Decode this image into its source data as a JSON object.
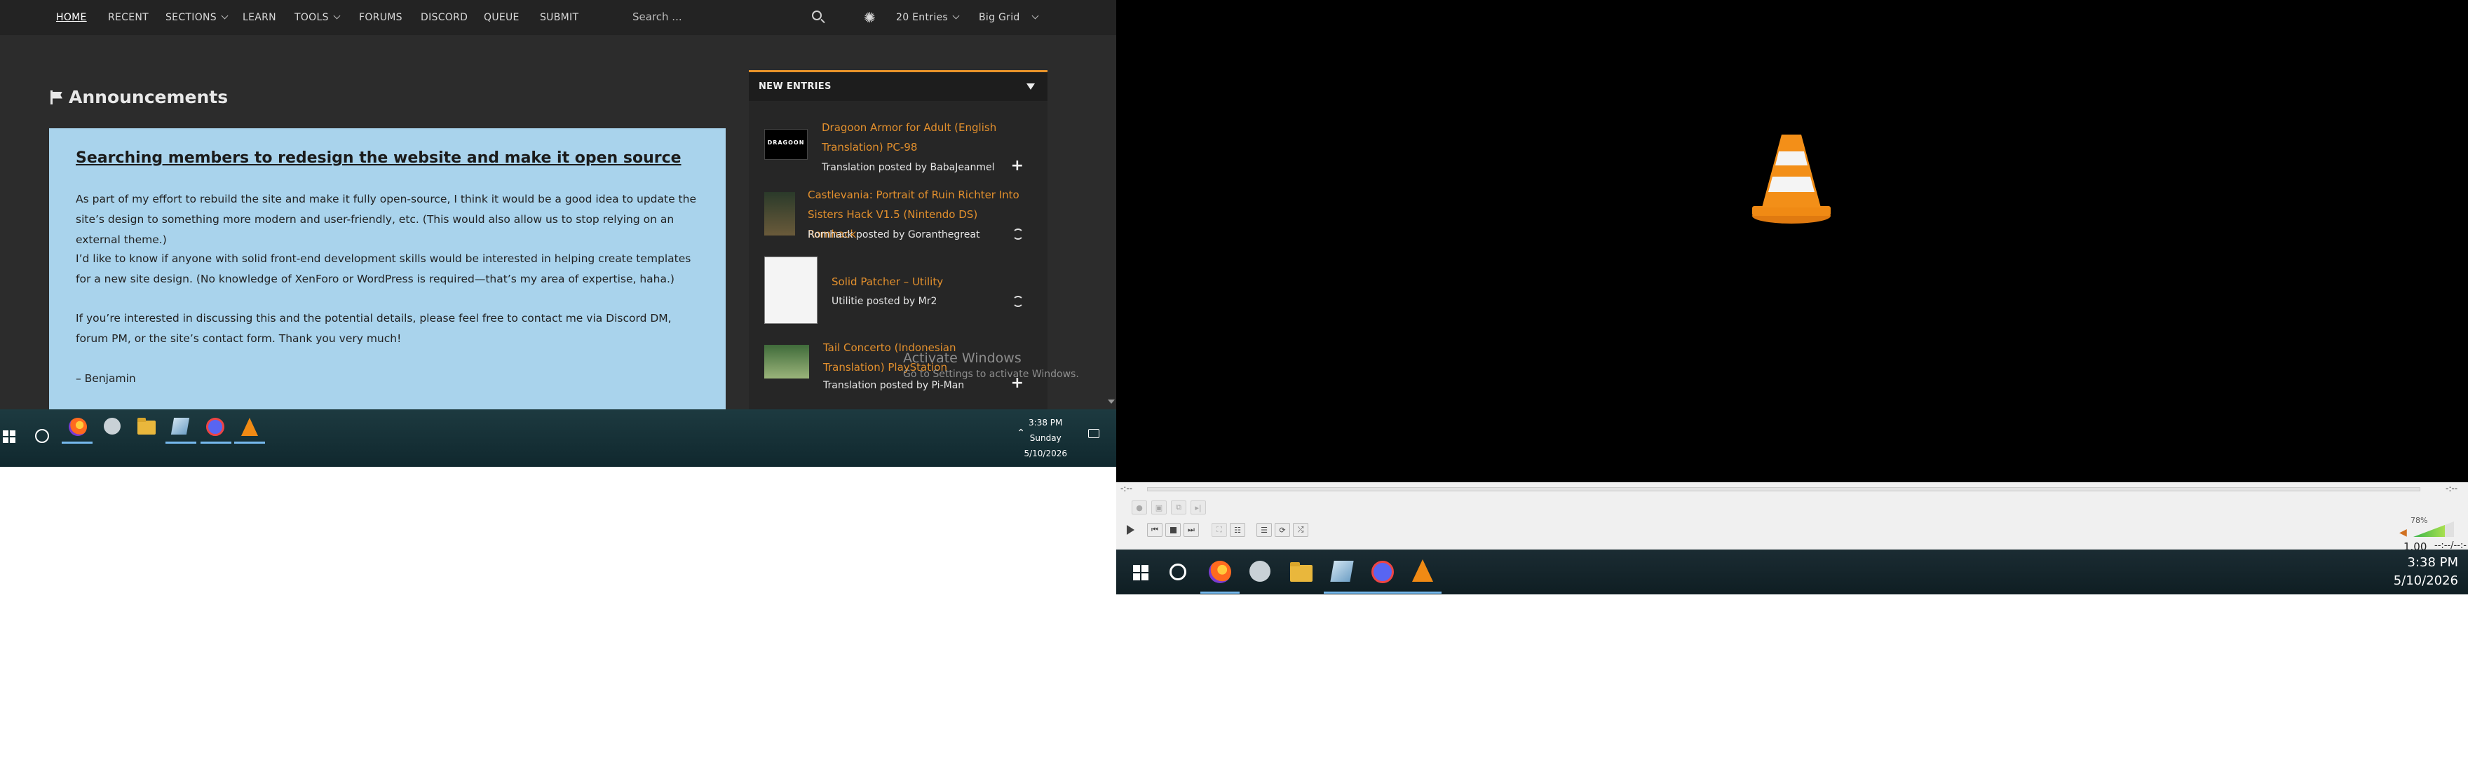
{
  "left_monitor": {
    "navbar": {
      "items": [
        {
          "label": "HOME"
        },
        {
          "label": "RECENT"
        },
        {
          "label": "SECTIONS"
        },
        {
          "label": "LEARN"
        },
        {
          "label": "TOOLS"
        },
        {
          "label": "FORUMS"
        },
        {
          "label": "DISCORD"
        },
        {
          "label": "QUEUE"
        },
        {
          "label": "SUBMIT"
        }
      ],
      "search_placeholder": "Search ...",
      "entries_select": "20 Entries",
      "grid_select": "Big Grid"
    },
    "announcements": {
      "heading": "Announcements",
      "title": "Searching members to redesign the website and make it open source",
      "paragraphs": [
        "As part of my effort to rebuild the site and make it fully open-source, I think it would be a good idea to update the site’s design to something more modern and user-friendly, etc. (This would also allow us to stop relying on an external theme.)",
        "I’d like to know if anyone with solid front-end development skills would be interested in helping create templates for a new site design. (No knowledge of XenForo or WordPress is required—that’s my area of expertise, haha.)",
        "If you’re interested in discussing this and the potential details, please feel free to contact me via Discord DM, forum PM, or the site’s contact form. Thank you very much!",
        "– Benjamin"
      ]
    },
    "new_entries": {
      "header": "NEW ENTRIES",
      "items": [
        {
          "title": "Dragoon Armor for Adult (English Translation) PC-98",
          "meta": "Translation posted by BabaJeanmel",
          "action": "plus"
        },
        {
          "title": "Castlevania: Portrait of Ruin Richter Into Sisters Hack V1.5 (Nintendo DS) Romhack",
          "meta": "Romhack posted by Goranthegreat",
          "action": "sync"
        },
        {
          "title": "Solid Patcher – Utility",
          "meta": "Utilitie posted by Mr2",
          "action": "sync"
        },
        {
          "title": "Tail Concerto (Indonesian Translation) PlayStation",
          "meta": "Translation posted by Pi-Man",
          "action": "plus"
        }
      ]
    },
    "watermark": {
      "line1": "Activate Windows",
      "line2": "Go to Settings to activate Windows."
    },
    "taskbar": {
      "time": "3:38 PM",
      "day": "Sunday",
      "date": "5/10/2026"
    }
  },
  "right_monitor": {
    "vlc": {
      "time_left": "-:--",
      "time_right": "-:--",
      "volume": "78%",
      "volume_level": 0.78,
      "rate": "1.00",
      "time_display": "--:--/--:--"
    },
    "taskbar": {
      "time": "3:38 PM",
      "date": "5/10/2026"
    }
  }
}
